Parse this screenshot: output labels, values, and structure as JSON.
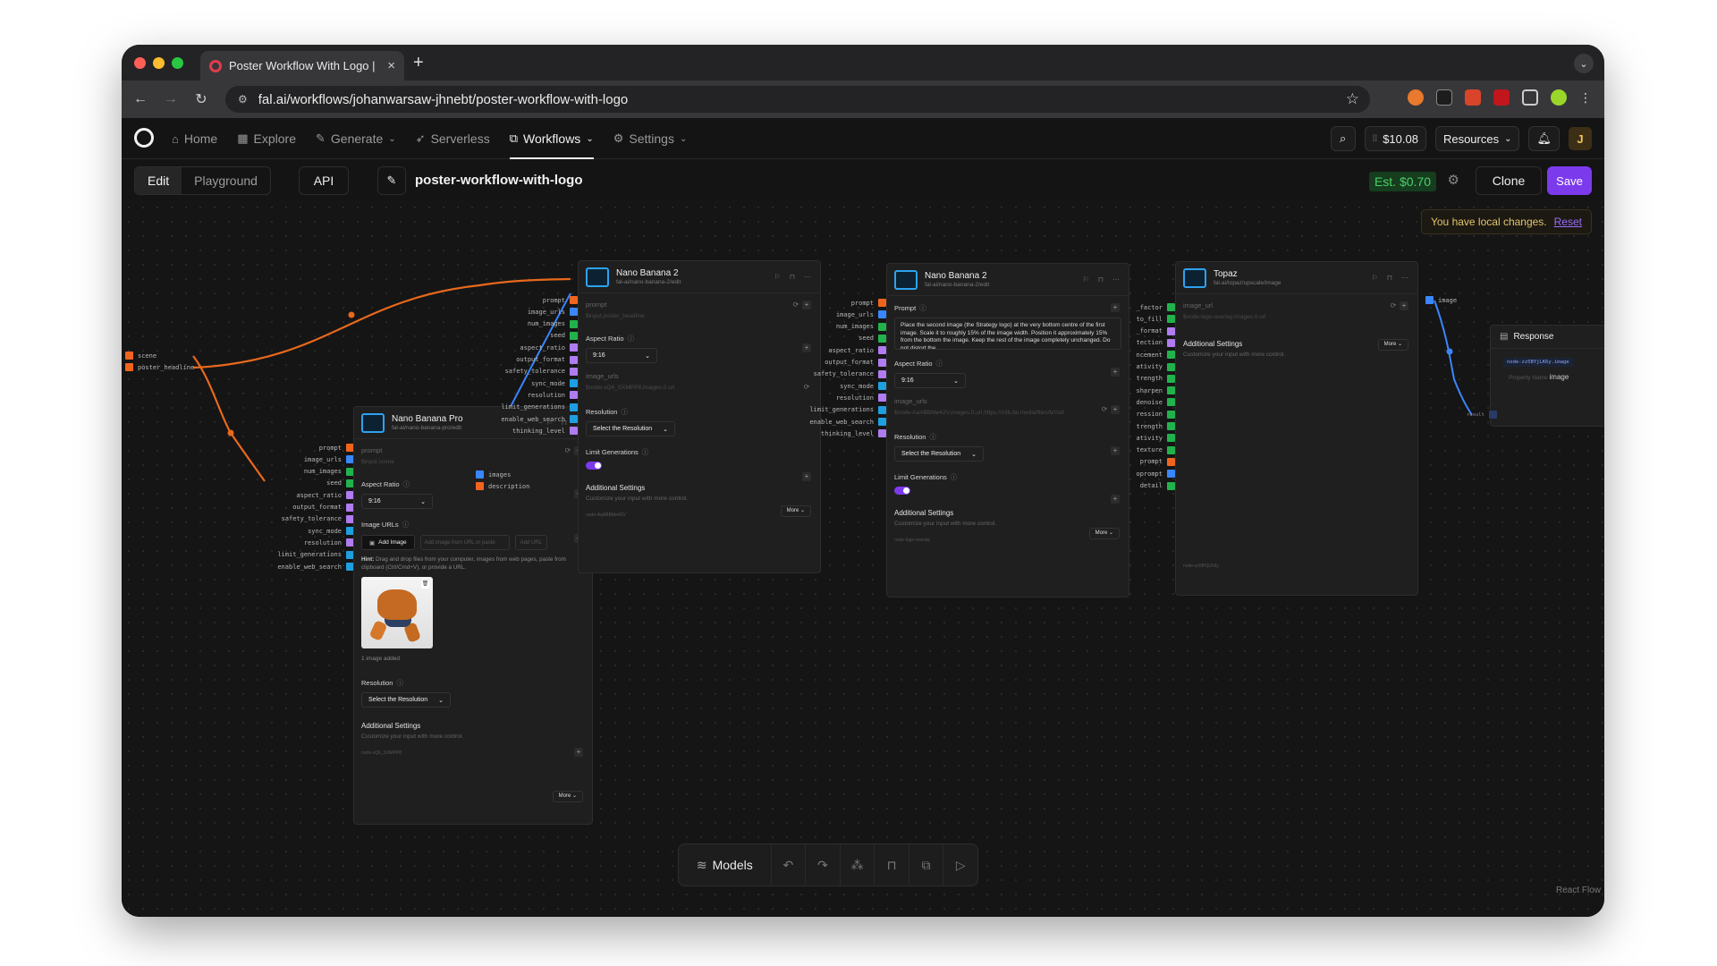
{
  "browser": {
    "tab_title": "Poster Workflow With Logo |",
    "url": "fal.ai/workflows/johanwarsaw-jhnebt/poster-workflow-with-logo"
  },
  "nav": {
    "items": [
      {
        "label": "Home",
        "icon": "home-icon"
      },
      {
        "label": "Explore",
        "icon": "grid-icon"
      },
      {
        "label": "Generate",
        "icon": "wand-icon"
      },
      {
        "label": "Serverless",
        "icon": "rocket-icon"
      },
      {
        "label": "Workflows",
        "icon": "workflow-icon"
      },
      {
        "label": "Settings",
        "icon": "gear-icon"
      }
    ],
    "balance": "$10.08",
    "resources": "Resources",
    "avatar_letter": "J"
  },
  "toolbar": {
    "edit": "Edit",
    "playground": "Playground",
    "api": "API",
    "workflow_name": "poster-workflow-with-logo",
    "estimate": "Est. $0.70",
    "clone": "Clone",
    "save": "Save"
  },
  "notice": {
    "text": "You have local changes.",
    "reset": "Reset"
  },
  "inputs": {
    "scene": "scene",
    "poster_headline": "poster_headline"
  },
  "node_pro": {
    "title": "Nano Banana Pro",
    "subtitle": "fal-ai/nano-banana-pro/edit",
    "prompt_label": "prompt",
    "prompt_placeholder": "$input.scene",
    "aspect_label": "Aspect Ratio",
    "aspect_value": "9:16",
    "image_urls_label": "Image URLs",
    "add_image": "Add Image",
    "url_placeholder": "Add image from URL or paste",
    "add_url": "Add URL",
    "hint_bold": "Hint:",
    "hint": "Drag and drop files from your computer, images from web pages, paste from clipboard (Ctrl/Cmd+V), or provide a URL.",
    "images_added": "1 image added",
    "resolution_label": "Resolution",
    "resolution_select": "Select the Resolution",
    "additional": "Additional Settings",
    "additional_sub": "Customize your input with more control.",
    "more": "More",
    "node_id": "node-sQ6_SXMPP8",
    "ports": [
      "prompt",
      "image_urls",
      "num_images",
      "seed",
      "aspect_ratio",
      "output_format",
      "safety_tolerance",
      "sync_mode",
      "resolution",
      "limit_generations",
      "enable_web_search"
    ]
  },
  "node_b1": {
    "title": "Nano Banana 2",
    "subtitle": "fal-ai/nano-banana-2/edit",
    "prompt_label": "prompt",
    "prompt_placeholder": "$input.poster_headline",
    "aspect_label": "Aspect Ratio",
    "aspect_value": "9:16",
    "image_urls_label": "image_urls",
    "image_urls_placeholder": "$node-sQ6_SXMPP8.images.0.url",
    "resolution_label": "Resolution",
    "resolution_select": "Select the Resolution",
    "limit_label": "Limit Generations",
    "additional": "Additional Settings",
    "additional_sub": "Customize your input with more control.",
    "more": "More",
    "node_id": "node-AaABBMe42V",
    "ports_in": [
      "prompt",
      "image_urls",
      "num_images",
      "seed",
      "aspect_ratio",
      "output_format",
      "safety_tolerance",
      "sync_mode",
      "resolution",
      "limit_generations",
      "enable_web_search",
      "thinking_level"
    ],
    "ports_out": [
      "images",
      "description"
    ]
  },
  "node_b2": {
    "title": "Nano Banana 2",
    "subtitle": "fal-ai/nano-banana-2/edit",
    "prompt_label": "Prompt",
    "prompt_text": "Place the second image (the Strategy logo) at the very bottom centre of the first image. Scale it to roughly 15% of the image width. Position it approximately 15% from the bottom the image. Keep the rest of the image completely unchanged. Do not distort the",
    "aspect_label": "Aspect Ratio",
    "aspect_value": "9:16",
    "image_urls_label": "image_urls",
    "image_urls_placeholder": "$node-AaABBMe42V.images.0.url,https://v3b.fal.media/files/b/0a9",
    "resolution_label": "Resolution",
    "resolution_select": "Select the Resolution",
    "limit_label": "Limit Generations",
    "additional": "Additional Settings",
    "additional_sub": "Customize your input with more control.",
    "more": "More",
    "node_id": "node-logo-overlay",
    "ports_in": [
      "prompt",
      "image_urls",
      "num_images",
      "seed",
      "aspect_ratio",
      "output_format",
      "safety_tolerance",
      "sync_mode",
      "resolution",
      "limit_generations",
      "enable_web_search",
      "thinking_level"
    ],
    "ports_out": [
      "images",
      "description"
    ]
  },
  "node_topaz": {
    "title": "Topaz",
    "subtitle": "fal-ai/topaz/upscale/image",
    "image_url_label": "image_url",
    "image_url_placeholder": "$node-logo-overlay.images.0.url",
    "additional": "Additional Settings",
    "additional_sub": "Customize your input with more control.",
    "more": "More",
    "node_id": "node-zz5BYjLK6y",
    "ports_in": [
      "_factor",
      "to_fill",
      "_format",
      "tection",
      "ncement",
      "ativity",
      "trength",
      "sharpen",
      "denoise",
      "ression",
      "trength",
      "ativity",
      "texture",
      "prompt",
      "oprompt",
      "detail"
    ],
    "port_out": "image"
  },
  "response": {
    "title": "Response",
    "result_port": "result",
    "chip": "node-zz5BYjLK6y.image",
    "property_label": "Property Name",
    "property_value": "image"
  },
  "bottom": {
    "models": "Models"
  },
  "footer": "React Flow",
  "colors": {
    "edge": "#e8691c",
    "edge_blue": "#3a86ff",
    "accent": "#7c3aed",
    "port_string": "#f0651e",
    "port_url": "#3a86ff",
    "port_int": "#22b24c",
    "port_enum": "#b07cf0",
    "port_bool": "#1e9fe0"
  }
}
